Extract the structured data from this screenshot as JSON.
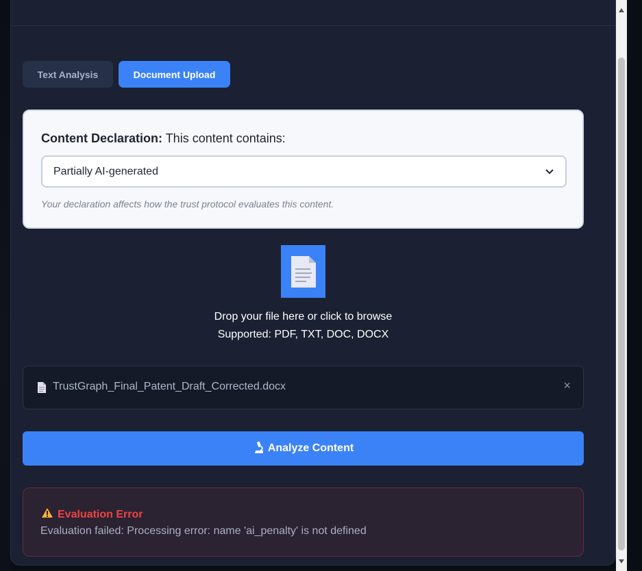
{
  "tabs": {
    "text_analysis": "Text Analysis",
    "document_upload": "Document Upload"
  },
  "declaration": {
    "label_bold": "Content Declaration:",
    "label_rest": " This content contains:",
    "selected": "Partially AI-generated",
    "note": "Your declaration affects how the trust protocol evaluates this content."
  },
  "dropzone": {
    "line1": "Drop your file here or click to browse",
    "line2": "Supported: PDF, TXT, DOC, DOCX",
    "icon": "document-icon"
  },
  "file": {
    "name": "TrustGraph_Final_Patent_Draft_Corrected.docx",
    "remove": "×"
  },
  "analyze": {
    "label": "Analyze Content",
    "icon": "microscope-icon"
  },
  "error": {
    "title": "Evaluation Error",
    "message": "Evaluation failed: Processing error: name 'ai_penalty' is not defined",
    "icon": "warning-icon"
  },
  "colors": {
    "accent": "#3b82f6",
    "panel": "#1b2132",
    "error": "#ef4444"
  }
}
